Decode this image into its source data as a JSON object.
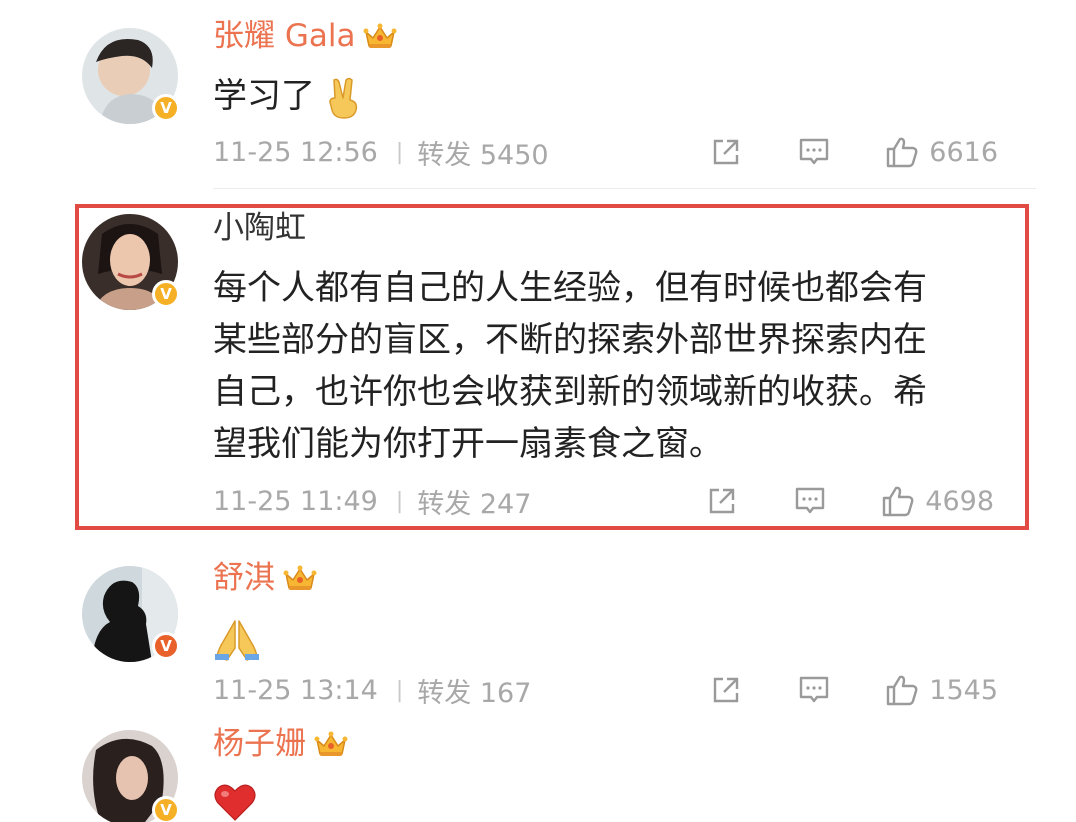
{
  "comments": [
    {
      "username": "张耀 Gala",
      "vip": true,
      "badge": "gold-v",
      "content": "学习了",
      "emoji": "victory-hand",
      "time": "11-25 12:56",
      "repost_label": "转发 5450",
      "likes": "6616"
    },
    {
      "username": "小陶虹",
      "vip": false,
      "badge": "gold-v",
      "content_lines": [
        "每个人都有自己的人生经验，但有时候也都会有",
        "某些部分的盲区，不断的探索外部世界探索内在",
        "自己，也许你也会收获到新的领域新的收获。希",
        "望我们能为你打开一扇素食之窗。"
      ],
      "time": "11-25 11:49",
      "repost_label": "转发 247",
      "likes": "4698",
      "highlight_color": "#e24a44"
    },
    {
      "username": "舒淇",
      "vip": true,
      "badge": "red-v",
      "content": "",
      "emoji": "folded-hands",
      "time": "11-25 13:14",
      "repost_label": "转发 167",
      "likes": "1545"
    },
    {
      "username": "杨子姗",
      "vip": true,
      "badge": "gold-v",
      "content": "",
      "emoji": "red-heart"
    }
  ],
  "icons": {
    "repost": "share-icon",
    "comment": "comment-icon",
    "like": "thumbs-up-icon",
    "vip": "crown-icon"
  },
  "colors": {
    "vip_name": "#eb7350",
    "meta_gray": "#a8a8a8",
    "highlight": "#e24a44"
  }
}
